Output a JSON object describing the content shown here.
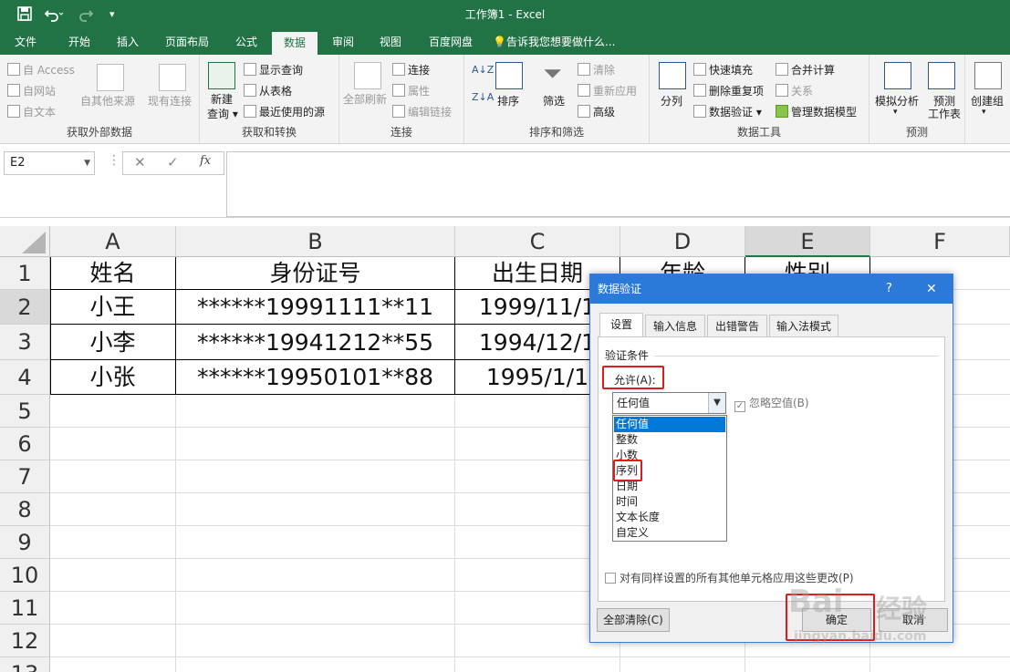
{
  "window": {
    "title": "工作簿1 - Excel",
    "save_icon": "save-icon",
    "undo_icon": "undo-icon",
    "redo_icon": "redo-icon"
  },
  "tabs": [
    "文件",
    "开始",
    "插入",
    "页面布局",
    "公式",
    "数据",
    "审阅",
    "视图",
    "百度网盘"
  ],
  "active_tab": "数据",
  "tell_me": "告诉我您想要做什么...",
  "ribbon": {
    "get_external": {
      "label": "获取外部数据",
      "access": "自 Access",
      "web": "自网站",
      "text": "自文本",
      "other": "自其他来源",
      "existing": "现有连接"
    },
    "transform": {
      "label": "获取和转换",
      "new_query_1": "新建",
      "new_query_2": "查询",
      "show_query": "显示查询",
      "from_table": "从表格",
      "recent": "最近使用的源"
    },
    "connections": {
      "label": "连接",
      "refresh_all": "全部刷新",
      "connections": "连接",
      "properties": "属性",
      "edit_links": "编辑链接"
    },
    "sort_filter": {
      "label": "排序和筛选",
      "sort": "排序",
      "filter": "筛选",
      "clear": "清除",
      "reapply": "重新应用",
      "advanced": "高级"
    },
    "data_tools": {
      "label": "数据工具",
      "split": "分列",
      "flash_fill": "快速填充",
      "remove_dup": "删除重复项",
      "validation": "数据验证",
      "consolidate": "合并计算",
      "relationships": "关系",
      "manage_model": "管理数据模型"
    },
    "forecast": {
      "label": "预测",
      "what_if": "模拟分析",
      "forecast_sheet_1": "预测",
      "forecast_sheet_2": "工作表"
    },
    "outline": {
      "group": "创建组"
    }
  },
  "formula_bar": {
    "name_box": "E2",
    "cancel": "✕",
    "enter": "✓",
    "fx": "fx",
    "value": ""
  },
  "sheet": {
    "columns": [
      "A",
      "B",
      "C",
      "D",
      "E",
      "F"
    ],
    "rows": [
      "1",
      "2",
      "3",
      "4",
      "5",
      "6",
      "7",
      "8",
      "9",
      "10",
      "11",
      "12",
      "13"
    ],
    "selected_cell": "E2",
    "header_row": [
      "姓名",
      "身份证号",
      "出生日期",
      "年龄",
      "性别"
    ],
    "data_rows": [
      [
        "小王",
        "******19991111**11",
        "1999/11/1"
      ],
      [
        "小李",
        "******19941212**55",
        "1994/12/1"
      ],
      [
        "小张",
        "******19950101**88",
        "1995/1/1"
      ]
    ]
  },
  "dialog": {
    "title": "数据验证",
    "help": "?",
    "close": "✕",
    "tabs": [
      "设置",
      "输入信息",
      "出错警告",
      "输入法模式"
    ],
    "active_tab": "设置",
    "section": "验证条件",
    "allow_label": "允许(A):",
    "allow_value": "任何值",
    "ignore_blank": "忽略空值(B)",
    "options": [
      "任何值",
      "整数",
      "小数",
      "序列",
      "日期",
      "时间",
      "文本长度",
      "自定义"
    ],
    "highlighted_option": "任何值",
    "apply_all": "对有同样设置的所有其他单元格应用这些更改(P)",
    "clear_all": "全部清除(C)",
    "ok": "确定",
    "cancel": "取消"
  },
  "watermark": {
    "brand": "Bai",
    "brand2": "经验",
    "url": "jingyan.baidu.com"
  },
  "colors": {
    "excel_green": "#217346",
    "dialog_blue": "#2b79d8",
    "highlight": "#0078d7",
    "annotation_red": "#e01b1b"
  }
}
